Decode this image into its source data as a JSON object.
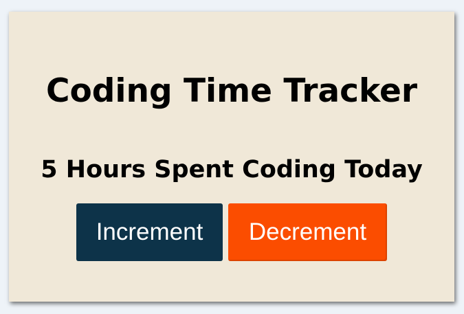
{
  "app": {
    "title": "Coding Time Tracker",
    "status_text": "5 Hours Spent Coding Today"
  },
  "controls": {
    "increment_label": "Increment",
    "decrement_label": "Decrement"
  },
  "colors": {
    "page_background": "#eef3f8",
    "card_background": "#f0e8d8",
    "increment_button": "#0d3349",
    "decrement_button": "#fb4d00",
    "text": "#000000"
  }
}
